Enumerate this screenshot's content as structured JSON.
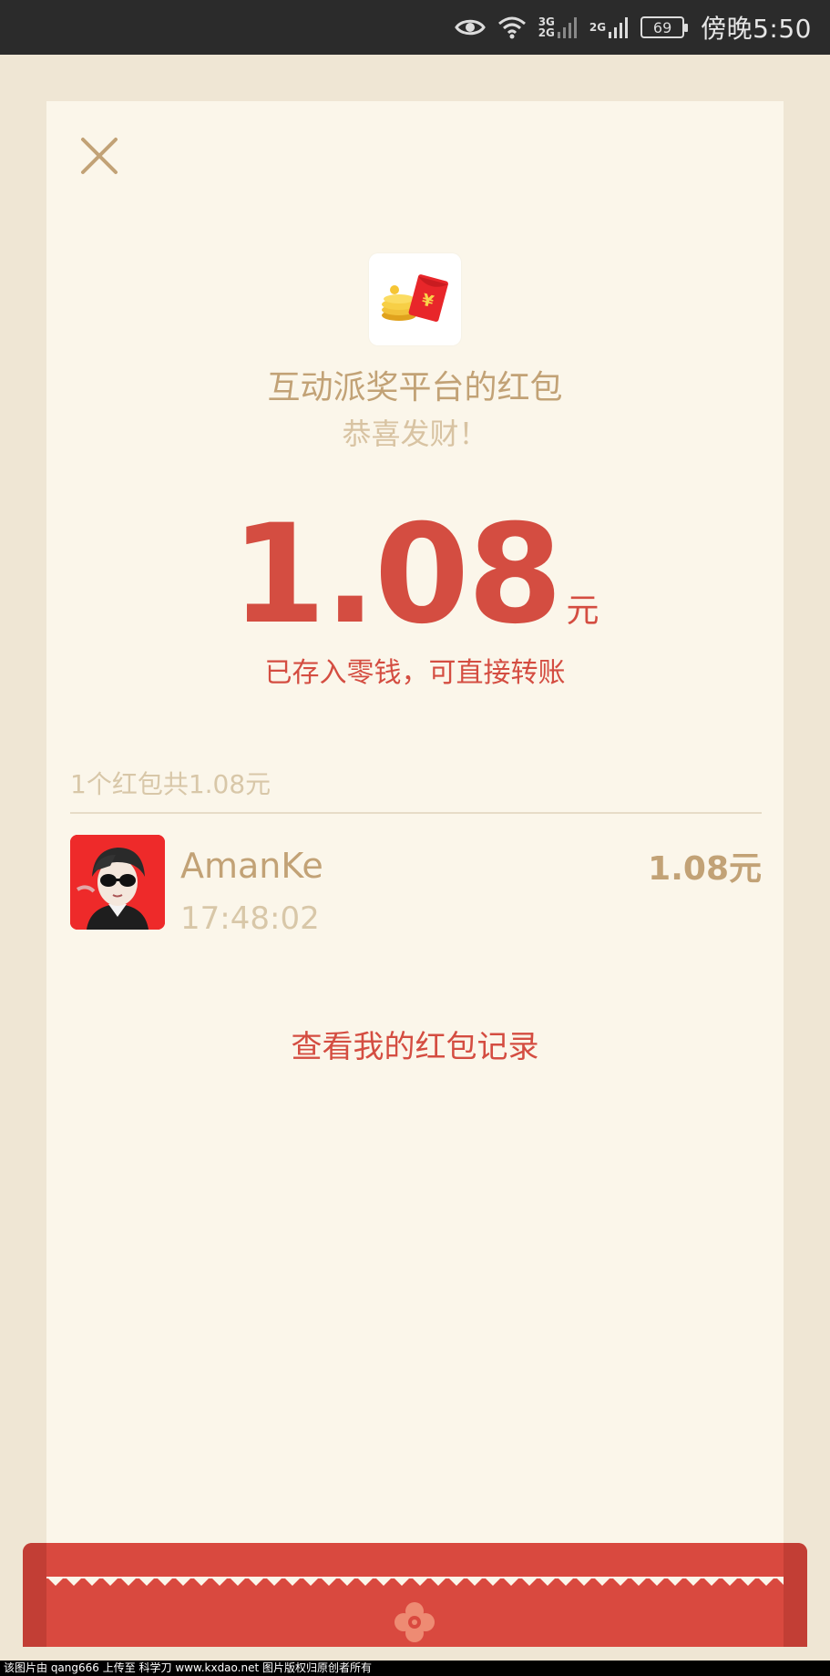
{
  "status_bar": {
    "network_top": "3G",
    "network_bottom": "2G",
    "network_2": "2G",
    "battery": "69",
    "time": "傍晚5:50"
  },
  "card": {
    "sender_title": "互动派奖平台的红包",
    "greeting": "恭喜发财！",
    "amount": "1.08",
    "amount_unit": "元",
    "deposit_note": "已存入零钱，可直接转账",
    "summary": "1个红包共1.08元",
    "records_link": "查看我的红包记录",
    "icons": {
      "close": "close-icon",
      "logo": "red-envelope-coins-icon",
      "bottom": "flower-icon"
    }
  },
  "receivers": [
    {
      "name": "AmanKe",
      "time": "17:48:02",
      "amount": "1.08元"
    }
  ],
  "footer": "该图片由 qang666 上传至 科学刀 www.kxdao.net 图片版权归原创者所有",
  "colors": {
    "accent_red": "#d44d41",
    "gold": "#c2a276",
    "light_gold": "#d8c7a8",
    "card_bg": "#fbf6ea",
    "page_bg": "#efe6d4"
  }
}
